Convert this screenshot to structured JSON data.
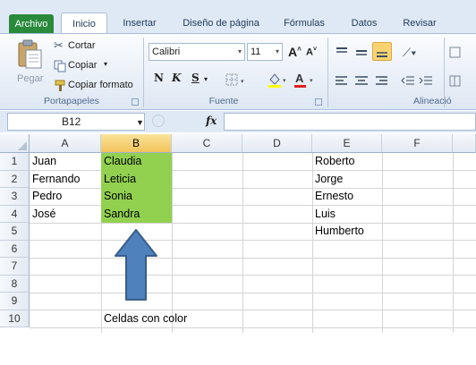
{
  "ribbon_tabs": [
    "Archivo",
    "Inicio",
    "Insertar",
    "Diseño de página",
    "Fórmulas",
    "Datos",
    "Revisar"
  ],
  "clipboard": {
    "paste_label": "Pegar",
    "cut_label": "Cortar",
    "copy_label": "Copiar",
    "format_painter_label": "Copiar formato",
    "group_label": "Portapapeles"
  },
  "font": {
    "family": "Calibri",
    "size": "11",
    "bold_label": "N",
    "italic_label": "K",
    "underline_label": "S",
    "group_label": "Fuente"
  },
  "alignment": {
    "group_label": "Alineació"
  },
  "formula_bar": {
    "name_box": "B12",
    "fx_label": "fx",
    "formula": ""
  },
  "sheet": {
    "columns": [
      "A",
      "B",
      "C",
      "D",
      "E",
      "F"
    ],
    "selected_column": "B",
    "rows": [
      "1",
      "2",
      "3",
      "4",
      "5",
      "6",
      "7",
      "8",
      "9",
      "10"
    ],
    "col_a": [
      "Juan",
      "Fernando",
      "Pedro",
      "José"
    ],
    "col_b": [
      "Claudia",
      "Leticia",
      "Sonia",
      "Sandra"
    ],
    "col_e": [
      "Roberto",
      "Jorge",
      "Ernesto",
      "Luis",
      "Humberto"
    ],
    "caption_b10": "Celdas con color",
    "highlight_color": "#92d050"
  },
  "annotation": {
    "arrow_color": "#4f81bd",
    "arrow_icon": "up-arrow-icon"
  }
}
